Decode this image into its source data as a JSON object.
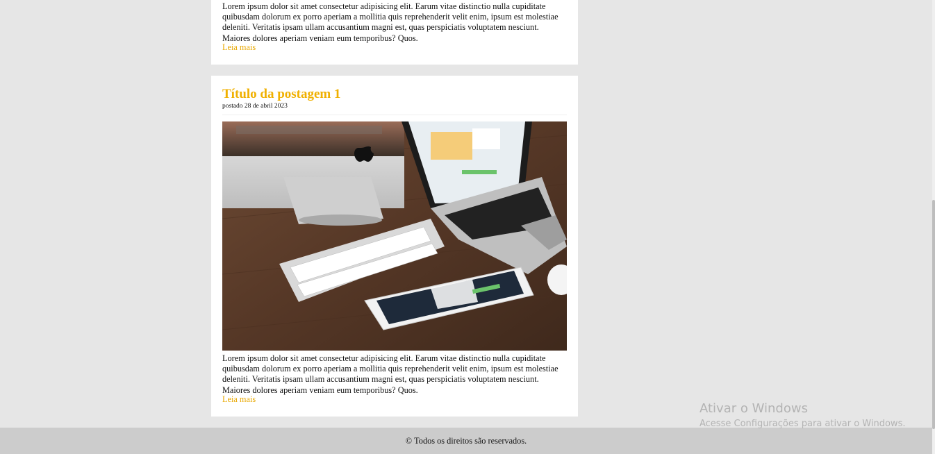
{
  "posts": [
    {
      "excerpt": "Lorem ipsum dolor sit amet consectetur adipisicing elit. Earum vitae distinctio nulla cupiditate quibusdam dolorum ex porro aperiam a mollitia quis reprehenderit velit enim, ipsum est molestiae deleniti. Veritatis ipsam ullam accusantium magni est, quas perspiciatis voluptatem nesciunt. Maiores dolores aperiam veniam eum temporibus? Quos.",
      "read_more": "Leia mais"
    },
    {
      "title": "Título da postagem 1",
      "date": "postado 28 de abril 2023",
      "image_icon": "desk-photo-icon",
      "excerpt": "Lorem ipsum dolor sit amet consectetur adipisicing elit. Earum vitae distinctio nulla cupiditate quibusdam dolorum ex porro aperiam a mollitia quis reprehenderit velit enim, ipsum est molestiae deleniti. Veritatis ipsam ullam accusantium magni est, quas perspiciatis voluptatem nesciunt. Maiores dolores aperiam veniam eum temporibus? Quos.",
      "read_more": "Leia mais"
    }
  ],
  "footer": {
    "copyright_symbol": "©",
    "text": "Todos os direitos são reservados."
  },
  "watermark": {
    "line1": "Ativar o Windows",
    "line2": "Acesse Configurações para ativar o Windows."
  },
  "colors": {
    "accent": "#f0b000",
    "page_bg": "#e6e6e6",
    "footer_bg": "#cccccc"
  }
}
